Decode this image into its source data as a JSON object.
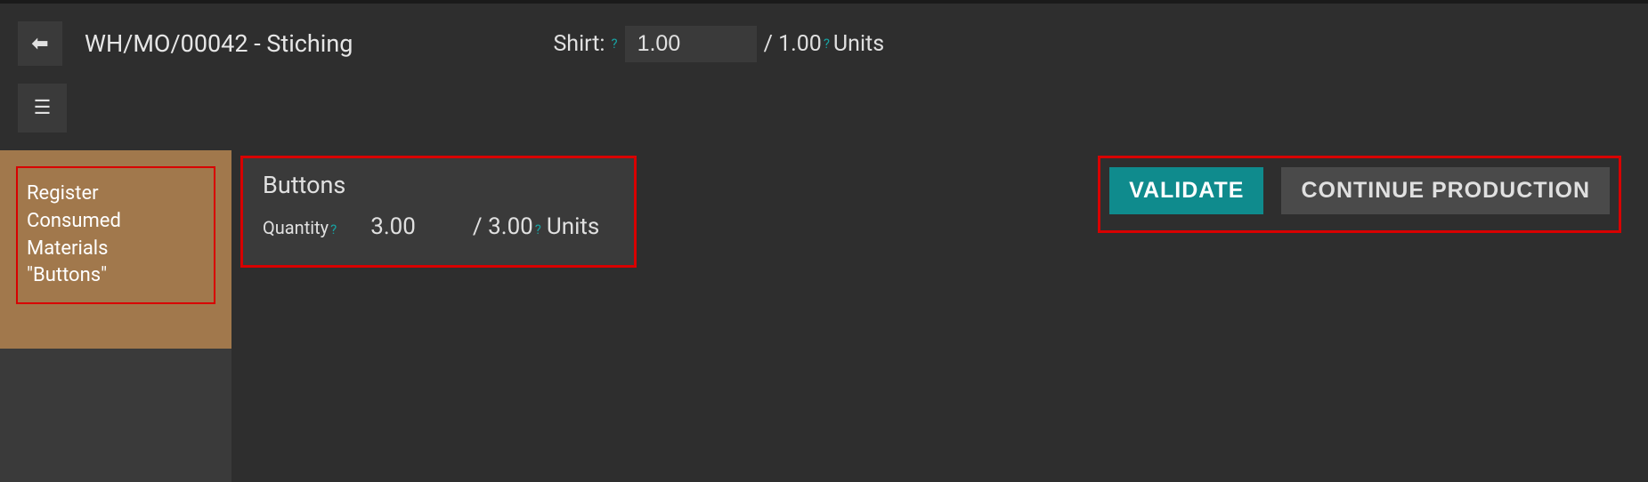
{
  "header": {
    "title": "WH/MO/00042 - Stiching",
    "product_label": "Shirt:",
    "qty_done": "1.00",
    "qty_total": "/ 1.00",
    "uom": "Units"
  },
  "side_card": {
    "line1": "Register",
    "line2": "Consumed",
    "line3": "Materials",
    "line4": "\"Buttons\""
  },
  "material": {
    "name": "Buttons",
    "qty_label": "Quantity",
    "qty_done": "3.00",
    "qty_total": "/ 3.00",
    "uom": "Units"
  },
  "actions": {
    "validate": "VALIDATE",
    "continue": "CONTINUE PRODUCTION"
  }
}
